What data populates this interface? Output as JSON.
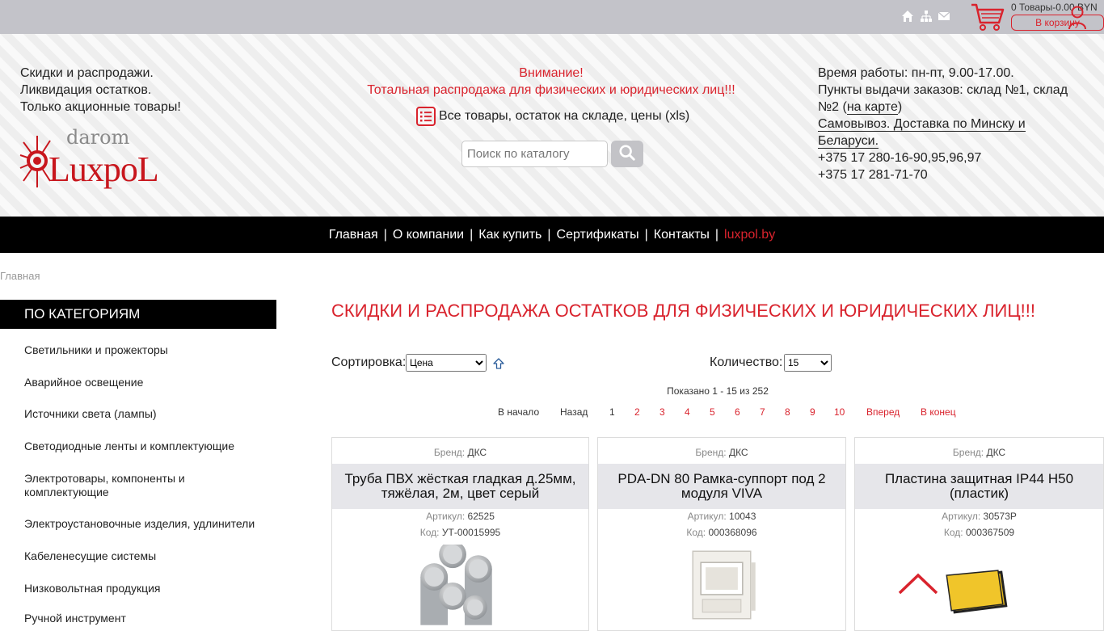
{
  "topbar": {
    "icons": [
      "home-icon",
      "sitemap-icon",
      "mail-icon",
      "cart-icon",
      "user-icon"
    ],
    "cart_summary": "0 Товары-0.00 BYN",
    "cart_button": "В корзину"
  },
  "header": {
    "promo": [
      "Скидки и распродажи.",
      "Ликвидация остатков.",
      "Только акционные товары!"
    ],
    "logo_top": "darom",
    "logo_main": "LuxpoL",
    "attention_title": "Внимание!",
    "attention_text": "Тотальная распродажа для физических и юридических лиц!!!",
    "xls_link": "Все товары, остаток на складе, цены (xls)",
    "search_placeholder": "Поиск по каталогу",
    "contacts": {
      "hours": "Время работы: пн-пт, 9.00-17.00.",
      "pickup_prefix": "Пункты выдачи заказов: склад №1, склад №2 (",
      "map_link": "на карте",
      "pickup_suffix": ")",
      "delivery": "Самовывоз. Доставка по Минску и Беларуси.",
      "phone1": "+375 17 280-16-90,95,96,97",
      "phone2": "+375 17 281-71-70"
    }
  },
  "nav": {
    "items": [
      "Главная",
      "О компании",
      "Как купить",
      "Сертификаты",
      "Контакты",
      "luxpol.by"
    ],
    "separator": "|"
  },
  "breadcrumb": "Главная",
  "sidebar": {
    "title": "ПО КАТЕГОРИЯМ",
    "items": [
      "Светильники и прожекторы",
      "Аварийное освещение",
      "Источники света (лампы)",
      "Светодиодные ленты и комплектующие",
      "Электротовары, компоненты и комплектующие",
      "Электроустановочные изделия, удлинители",
      "Кабеленесущие системы",
      "Низковольтная продукция",
      "Ручной инструмент"
    ]
  },
  "main": {
    "title": "СКИДКИ И РАСПРОДАЖА ОСТАТКОВ ДЛЯ ФИЗИЧЕСКИХ И ЮРИДИЧЕСКИХ ЛИЦ!!!",
    "sort_label": "Сортировка:",
    "sort_value": "Цена",
    "qty_label": "Количество:",
    "qty_value": "15",
    "shown": "Показано 1 - 15 из 252",
    "pager": {
      "first": "В начало",
      "prev": "Назад",
      "pages": [
        "1",
        "2",
        "3",
        "4",
        "5",
        "6",
        "7",
        "8",
        "9",
        "10"
      ],
      "current": "1",
      "next": "Вперед",
      "last": "В конец"
    }
  },
  "products": [
    {
      "brand_label": "Бренд:",
      "brand": "ДКС",
      "name": "Труба ПВХ жёсткая гладкая д.25мм, тяжёлая, 2м, цвет серый",
      "art_label": "Артикул:",
      "art": "62525",
      "code_label": "Код:",
      "code": "УТ-00015995"
    },
    {
      "brand_label": "Бренд:",
      "brand": "ДКС",
      "name": "PDA-DN 80 Рамка-суппорт под 2 модуля VIVA",
      "art_label": "Артикул:",
      "art": "10043",
      "code_label": "Код:",
      "code": "000368096"
    },
    {
      "brand_label": "Бренд:",
      "brand": "ДКС",
      "name": "Пластина защитная IP44 H50 (пластик)",
      "art_label": "Артикул:",
      "art": "30573P",
      "code_label": "Код:",
      "code": "000367509"
    }
  ],
  "colors": {
    "accent_red": "#d9232d",
    "topbar_gray": "#c3c3c9",
    "nav_black": "#000000"
  }
}
